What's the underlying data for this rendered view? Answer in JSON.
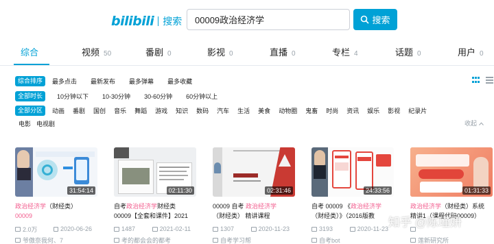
{
  "header": {
    "logo": "bilibili",
    "logo_suffix": "搜索",
    "search_value": "00009政治经济学",
    "search_button": "搜索"
  },
  "tabs": [
    {
      "label": "综合",
      "count": ""
    },
    {
      "label": "视频",
      "count": "50"
    },
    {
      "label": "番剧",
      "count": "0"
    },
    {
      "label": "影视",
      "count": "0"
    },
    {
      "label": "直播",
      "count": "0"
    },
    {
      "label": "专栏",
      "count": "4"
    },
    {
      "label": "话题",
      "count": "0"
    },
    {
      "label": "用户",
      "count": "0"
    }
  ],
  "filters": {
    "sort": [
      "综合排序",
      "最多点击",
      "最新发布",
      "最多弹幕",
      "最多收藏"
    ],
    "duration": [
      "全部时长",
      "10分钟以下",
      "10-30分钟",
      "30-60分钟",
      "60分钟以上"
    ],
    "zone": [
      "全部分区",
      "动画",
      "番剧",
      "国创",
      "音乐",
      "舞蹈",
      "游戏",
      "知识",
      "数码",
      "汽车",
      "生活",
      "美食",
      "动物圈",
      "鬼畜",
      "时尚",
      "资讯",
      "娱乐",
      "影视",
      "纪录片"
    ],
    "zone2": [
      "电影",
      "电视剧"
    ],
    "collapse": "收起"
  },
  "videos": [
    {
      "duration": "31:54:14",
      "title_hl": "政治经济学",
      "title_rest": "（财经类）",
      "title_line2": "00009",
      "views": "2.0万",
      "date": "2020-06-26",
      "uploader": "爷傲奈我何、7"
    },
    {
      "duration": "02:11:30",
      "title_pre": "自考",
      "title_hl": "政治经济学",
      "title_rest": "财经类",
      "title_line2": "00009【全套和课件】2021",
      "views": "1487",
      "date": "2021-02-11",
      "uploader": "考的都会会的都考"
    },
    {
      "duration": "02:31:46",
      "title_pre": "00009 自考 ",
      "title_hl": "政治经济学",
      "title_rest": "",
      "title_line2": "（财经类） 精讲课程",
      "views": "1307",
      "date": "2020-11-23",
      "uploader": "自考学习帮"
    },
    {
      "duration": "24:33:56",
      "title_pre": "自考 00009 《",
      "title_hl": "政治经济学",
      "title_rest": "",
      "title_line2": "（财经类）》（2016版教",
      "views": "3193",
      "date": "2020-11-23",
      "uploader": "自考bot"
    },
    {
      "duration": "01:31:33",
      "title_pre": "",
      "title_hl": "政治经济学",
      "title_rest": "（财经类）系统",
      "title_line2": "精讲1（课程代码00009）",
      "views": "",
      "date": "",
      "uploader": "莲新研究所"
    }
  ],
  "watermark": "知乎 @陈瑾妍"
}
